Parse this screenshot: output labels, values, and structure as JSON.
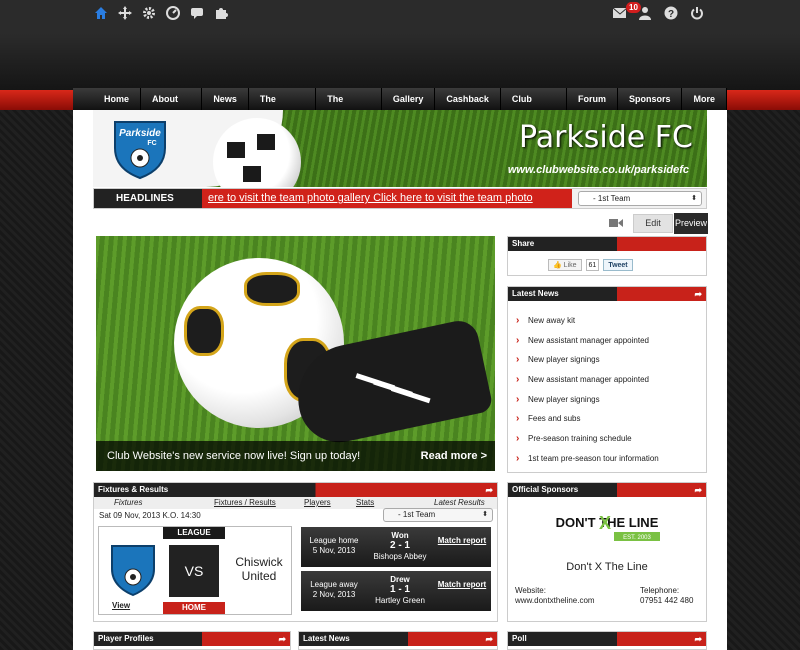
{
  "topbar": {
    "mail_badge": "10"
  },
  "nav": [
    "Home",
    "About Us",
    "News",
    "The Teams",
    "The Match",
    "Gallery",
    "Cashback",
    "Club Shop",
    "Forum",
    "Sponsors",
    "More"
  ],
  "banner": {
    "title": "Parkside FC",
    "url": "www.clubwebsite.co.uk/parksidefc",
    "crest_text": "Parkside",
    "crest_sub": "FC"
  },
  "headlines": {
    "label": "HEADLINES",
    "ticker": "ere to visit the team photo gallery Click here to visit the team photo",
    "team_select": "- 1st Team"
  },
  "toolbar": {
    "edit": "Edit",
    "preview": "Preview"
  },
  "hero": {
    "caption": "Club Website's new service now live! Sign up today!",
    "read_more": "Read more >"
  },
  "share": {
    "title": "Share",
    "like": "Like",
    "like_count": "61",
    "tweet": "Tweet"
  },
  "latest_news": {
    "title": "Latest News",
    "items": [
      "New away kit",
      "New assistant manager appointed",
      "New player signings",
      "New assistant manager appointed",
      "New player signings",
      "Fees and subs",
      "Pre-season training schedule",
      "1st team pre-season tour information"
    ]
  },
  "fixtures": {
    "title": "Fixtures & Results",
    "tabs": {
      "fixtures": "Fixtures",
      "fixtures_results": "Fixtures / Results",
      "players": "Players",
      "stats": "Stats",
      "latest_results": "Latest Results"
    },
    "date": "Sat 09 Nov, 2013 K.O. 14:30",
    "team_select": "- 1st Team",
    "card": {
      "league": "LEAGUE",
      "vs": "VS",
      "opponent": "Chiswick United",
      "home": "HOME",
      "view": "View"
    },
    "results": [
      {
        "venue": "League home",
        "date": "5 Nov, 2013",
        "outcome": "Won",
        "score": "2 - 1",
        "opponent": "Bishops Abbey",
        "link": "Match report"
      },
      {
        "venue": "League away",
        "date": "2 Nov, 2013",
        "outcome": "Drew",
        "score": "1 - 1",
        "opponent": "Hartley Green",
        "link": "Match report"
      }
    ]
  },
  "sponsors": {
    "title": "Official Sponsors",
    "logo_text": "DON'T THE LINE",
    "logo_x": "X",
    "logo_est": "EST. 2003",
    "name": "Don't X The Line",
    "website_label": "Website:",
    "website": "www.dontxtheline.com",
    "phone_label": "Telephone:",
    "phone": "07951 442 480"
  },
  "bottom": {
    "profiles": "Player Profiles",
    "news": "Latest News",
    "poll": "Poll"
  }
}
